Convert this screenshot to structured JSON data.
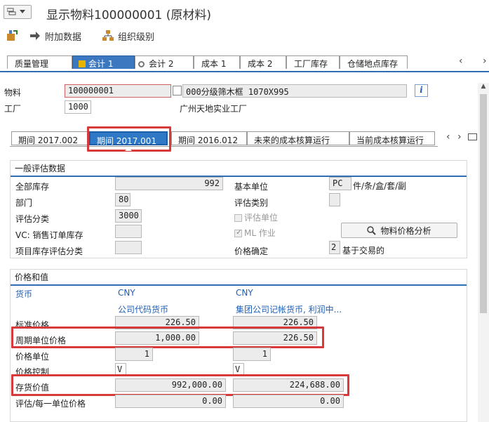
{
  "window": {
    "title": "显示物料100000001 (原材料)"
  },
  "toolbar": {
    "additional_data": "附加数据",
    "org_levels": "组织级别"
  },
  "view_tabs": [
    {
      "label": "质量管理"
    },
    {
      "label": "会计 1",
      "active": true
    },
    {
      "label": "会计 2"
    },
    {
      "label": "成本 1"
    },
    {
      "label": "成本 2"
    },
    {
      "label": "工厂库存"
    },
    {
      "label": "仓储地点库存"
    }
  ],
  "header": {
    "material_label": "物料",
    "material_value": "100000001",
    "material_desc": "000分级筛木框 1070X995",
    "plant_label": "工厂",
    "plant_value": "1000",
    "plant_desc": "广州天地实业工厂"
  },
  "period_tabs": [
    {
      "label": "期间 2017.002"
    },
    {
      "label": "期间 2017.001",
      "active": true
    },
    {
      "label": "期间 2016.012"
    },
    {
      "label": "未来的成本核算运行"
    },
    {
      "label": "当前成本核算运行"
    }
  ],
  "general": {
    "title": "一般评估数据",
    "total_stock_label": "全部库存",
    "total_stock_value": "992",
    "base_unit_label": "基本单位",
    "base_unit_value": "PC",
    "base_unit_desc": "件/条/盒/套/副",
    "division_label": "部门",
    "division_value": "80",
    "val_category_label": "评估类别",
    "val_class_label": "评估分类",
    "val_class_value": "3000",
    "val_unit_label": "评估单位",
    "vc_sales_label": "VC: 销售订单库存",
    "ml_label": "ML 作业",
    "price_analysis_button": "物料价格分析",
    "proj_stock_label": "项目库存评估分类",
    "price_det_label": "价格确定",
    "price_det_value": "2",
    "price_det_desc": "基于交易的"
  },
  "prices": {
    "title": "价格和值",
    "currency_label": "货币",
    "currency_1": "CNY",
    "currency_2": "CNY",
    "currency_1_desc": "公司代码货币",
    "currency_2_desc": "集团公司记帐货币, 利润中...",
    "std_price_label": "标准价格",
    "std_price_1": "226.50",
    "std_price_2": "226.50",
    "periodic_price_label": "周期单位价格",
    "periodic_price_1": "1,000.00",
    "periodic_price_2": "226.50",
    "price_unit_label": "价格单位",
    "price_unit_1": "1",
    "price_unit_2": "1",
    "price_control_label": "价格控制",
    "price_control_1": "V",
    "price_control_2": "V",
    "inventory_value_label": "存货价值",
    "inventory_value_1": "992,000.00",
    "inventory_value_2": "224,688.00",
    "val_per_unit_label": "评估/每一单位价格",
    "val_per_unit_1": "0.00",
    "val_per_unit_2": "0.00"
  },
  "colors": {
    "accent": "#2f6eb5",
    "highlight": "#d63a3a"
  }
}
